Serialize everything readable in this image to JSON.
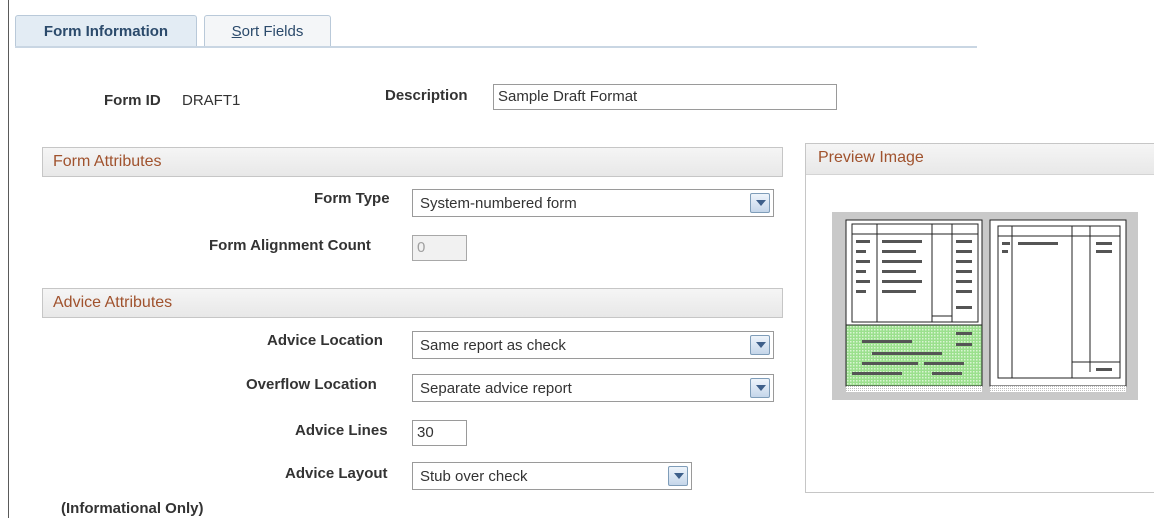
{
  "tabs": [
    {
      "label": "Form Information",
      "active": true
    },
    {
      "label": "Sort Fields",
      "active": false,
      "accesskey": "S"
    }
  ],
  "form": {
    "form_id_label": "Form ID",
    "form_id_value": "DRAFT1",
    "description_label": "Description",
    "description_value": "Sample Draft Format"
  },
  "form_attributes": {
    "title": "Form Attributes",
    "form_type_label": "Form Type",
    "form_type_value": "System-numbered form",
    "alignment_label": "Form Alignment Count",
    "alignment_value": "0"
  },
  "advice_attributes": {
    "title": "Advice Attributes",
    "location_label": "Advice Location",
    "location_value": "Same report as check",
    "overflow_label": "Overflow Location",
    "overflow_value": "Separate advice report",
    "lines_label": "Advice Lines",
    "lines_value": "30",
    "layout_label": "Advice Layout",
    "layout_value": "Stub over check",
    "informational": "(Informational Only)"
  },
  "preview": {
    "title": "Preview Image"
  }
}
